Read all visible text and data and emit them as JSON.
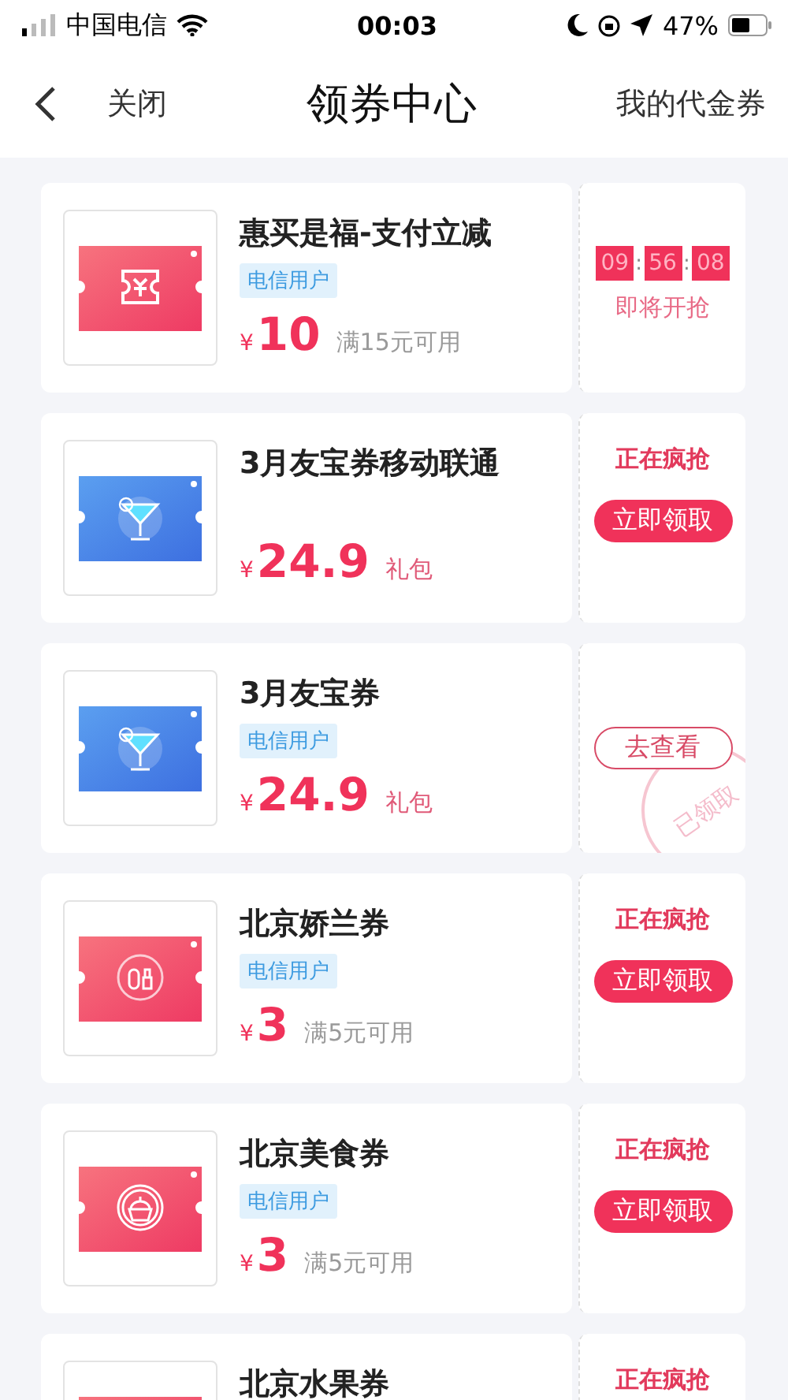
{
  "status_bar": {
    "carrier": "中国电信",
    "time": "00:03",
    "battery": "47%"
  },
  "nav": {
    "close": "关闭",
    "title": "领券中心",
    "my_coupons": "我的代金券"
  },
  "coupons": [
    {
      "kind": "cash",
      "title": "惠买是福-支付立减",
      "tag": "电信用户",
      "currency": "¥",
      "amount": "10",
      "note": {
        "kind": "condition",
        "text": "满15元可用"
      },
      "action": {
        "kind": "countdown",
        "digits": [
          "09",
          "56",
          "08"
        ],
        "separator": ":",
        "label": "即将开抢"
      }
    },
    {
      "kind": "drink",
      "title": "3月友宝券移动联通",
      "currency": "¥",
      "amount": "24.9",
      "note": {
        "kind": "package",
        "text": "礼包"
      },
      "action": {
        "kind": "grab",
        "status": "正在疯抢",
        "button": "立即领取"
      }
    },
    {
      "kind": "drink",
      "title": "3月友宝券",
      "tag": "电信用户",
      "currency": "¥",
      "amount": "24.9",
      "note": {
        "kind": "package",
        "text": "礼包"
      },
      "action": {
        "kind": "claimed",
        "button": "去查看",
        "stamp": "已领取"
      }
    },
    {
      "kind": "cosmetics",
      "title": "北京娇兰券",
      "tag": "电信用户",
      "currency": "¥",
      "amount": "3",
      "note": {
        "kind": "condition",
        "text": "满5元可用"
      },
      "action": {
        "kind": "grab",
        "status": "正在疯抢",
        "button": "立即领取"
      }
    },
    {
      "kind": "food",
      "title": "北京美食券",
      "tag": "电信用户",
      "currency": "¥",
      "amount": "3",
      "note": {
        "kind": "condition",
        "text": "满5元可用"
      },
      "action": {
        "kind": "grab",
        "status": "正在疯抢",
        "button": "立即领取"
      }
    },
    {
      "kind": "fruit",
      "title": "北京水果券",
      "action": {
        "kind": "grab",
        "status": "正在疯抢"
      }
    }
  ]
}
